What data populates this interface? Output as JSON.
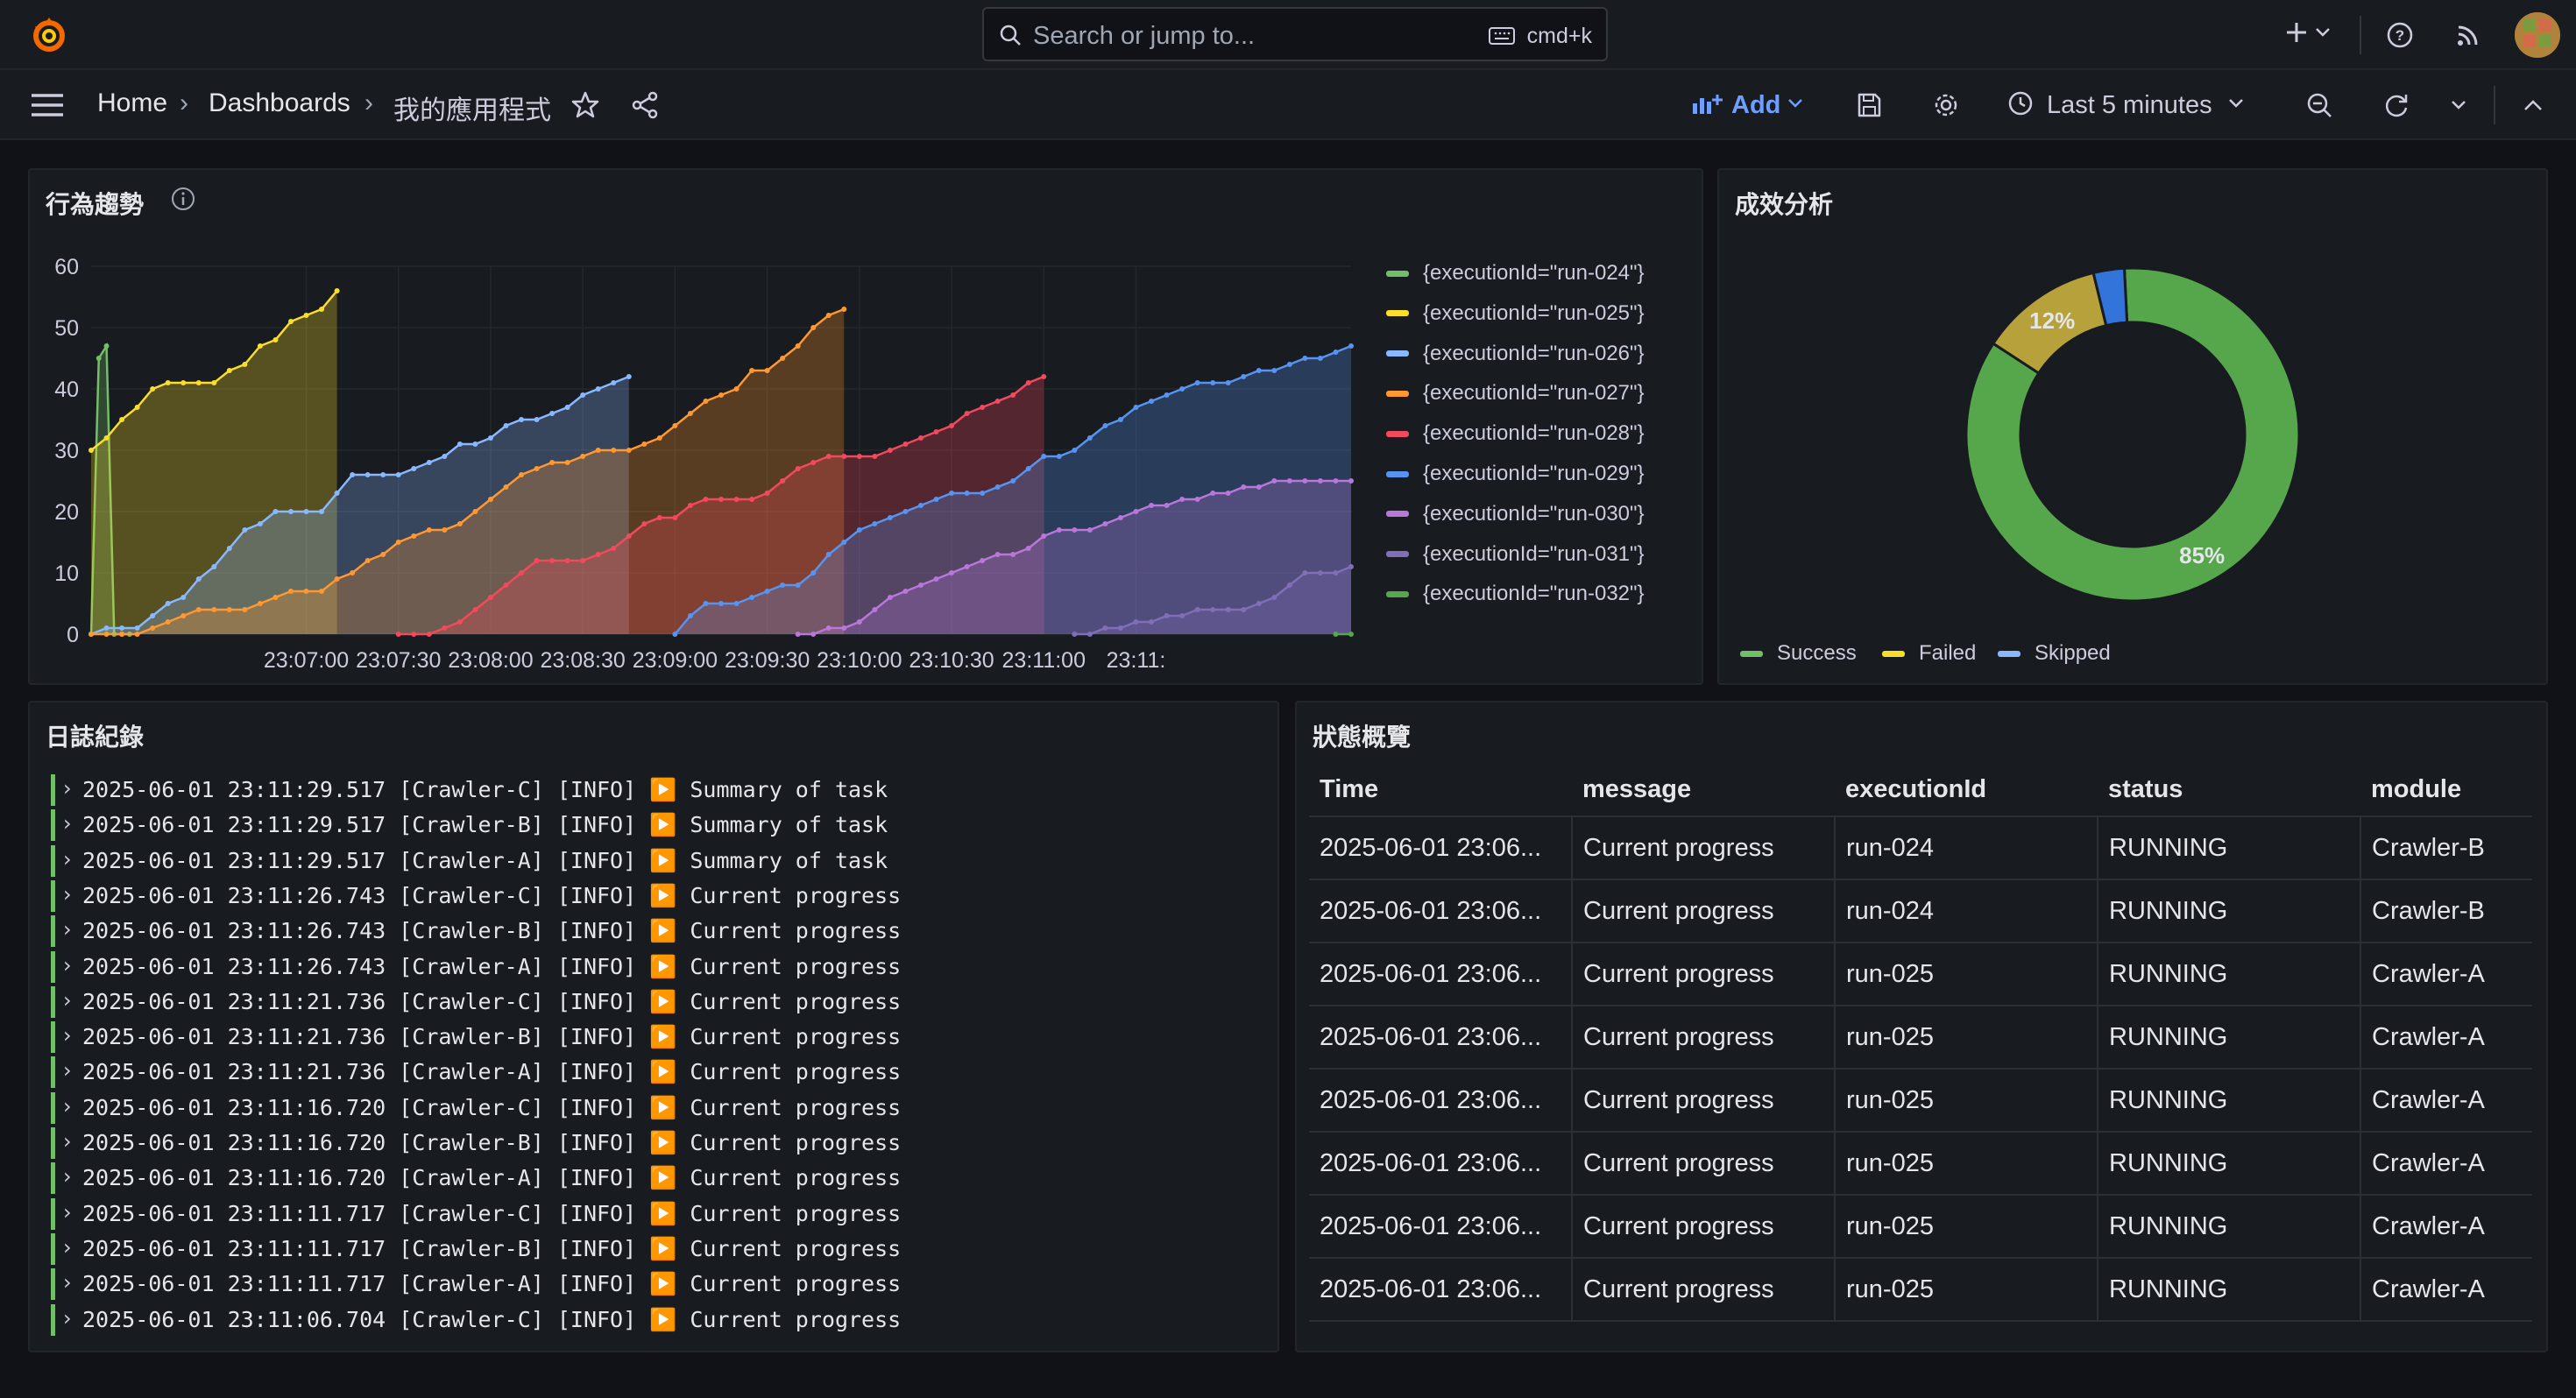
{
  "topbar": {
    "search_placeholder": "Search or jump to...",
    "search_shortcut": "cmd+k",
    "icons": [
      "grafana-logo-icon",
      "search-icon",
      "keyboard-icon",
      "plus-icon",
      "chevron-down-icon",
      "help-icon",
      "news-rss-icon",
      "user-avatar"
    ]
  },
  "breadcrumb": {
    "home": "Home",
    "dashboards": "Dashboards",
    "current": "我的應用程式"
  },
  "toolbar": {
    "add_label": "Add",
    "time_range": "Last 5 minutes",
    "accent": "#6e9fff"
  },
  "trend_panel": {
    "title": "行為趨勢",
    "chart_data": {
      "type": "area",
      "x_ticks": [
        "23:07:00",
        "23:07:30",
        "23:08:00",
        "23:08:30",
        "23:09:00",
        "23:09:30",
        "23:10:00",
        "23:10:30",
        "23:11:00",
        "23:11:"
      ],
      "y_ticks": [
        "0",
        "10",
        "20",
        "30",
        "40",
        "50",
        "60"
      ],
      "ylim": [
        0,
        60
      ],
      "legend_placement": "right",
      "grid": true,
      "series": [
        {
          "name": "{executionId=\"run-024\"}",
          "color": "#73bf69",
          "x": [
            0,
            2.5,
            5,
            7.5,
            10,
            12.5
          ],
          "y": [
            0,
            45,
            47,
            0,
            0,
            0
          ]
        },
        {
          "name": "{executionId=\"run-025\"}",
          "color": "#fade2a",
          "x": [
            0,
            5,
            10,
            15,
            20,
            25,
            30,
            35,
            40,
            45,
            50,
            55,
            60,
            65,
            70,
            75,
            80
          ],
          "y": [
            30,
            32,
            35,
            37,
            40,
            41,
            41,
            41,
            41,
            43,
            44,
            47,
            48,
            51,
            52,
            53,
            56
          ]
        },
        {
          "name": "{executionId=\"run-026\"}",
          "color": "#8ab8ff",
          "x": [
            0,
            5,
            10,
            15,
            20,
            25,
            30,
            35,
            40,
            45,
            50,
            55,
            60,
            65,
            70,
            75,
            80,
            85,
            90,
            95,
            100,
            105,
            110,
            115,
            120,
            125,
            130,
            135,
            140,
            145,
            150,
            155,
            160,
            165,
            170,
            175
          ],
          "y": [
            0,
            1,
            1,
            1,
            3,
            5,
            6,
            9,
            11,
            14,
            17,
            18,
            20,
            20,
            20,
            20,
            23,
            26,
            26,
            26,
            26,
            27,
            28,
            29,
            31,
            31,
            32,
            34,
            35,
            35,
            36,
            37,
            39,
            40,
            41,
            42
          ]
        },
        {
          "name": "{executionId=\"run-027\"}",
          "color": "#ff9830",
          "x": [
            0,
            5,
            10,
            15,
            20,
            25,
            30,
            35,
            40,
            45,
            50,
            55,
            60,
            65,
            70,
            75,
            80,
            85,
            90,
            95,
            100,
            105,
            110,
            115,
            120,
            125,
            130,
            135,
            140,
            145,
            150,
            155,
            160,
            165,
            170,
            175,
            180,
            185,
            190,
            195,
            200,
            205,
            210,
            215,
            220,
            225,
            230,
            235,
            240,
            245
          ],
          "y": [
            0,
            0,
            0,
            0,
            1,
            2,
            3,
            4,
            4,
            4,
            4,
            5,
            6,
            7,
            7,
            7,
            9,
            10,
            12,
            13,
            15,
            16,
            17,
            17,
            18,
            20,
            22,
            24,
            26,
            27,
            28,
            28,
            29,
            30,
            30,
            30,
            31,
            32,
            34,
            36,
            38,
            39,
            40,
            43,
            43,
            45,
            47,
            50,
            52,
            53
          ]
        },
        {
          "name": "{executionId=\"run-028\"}",
          "color": "#f2495c",
          "x": [
            100,
            105,
            110,
            115,
            120,
            125,
            130,
            135,
            140,
            145,
            150,
            155,
            160,
            165,
            170,
            175,
            180,
            185,
            190,
            195,
            200,
            205,
            210,
            215,
            220,
            225,
            230,
            235,
            240,
            245,
            250,
            255,
            260,
            265,
            270,
            275,
            280,
            285,
            290,
            295,
            300,
            305,
            310
          ],
          "y": [
            0,
            0,
            0,
            1,
            2,
            4,
            6,
            8,
            10,
            12,
            12,
            12,
            12,
            13,
            14,
            16,
            18,
            19,
            19,
            21,
            22,
            22,
            22,
            22,
            23,
            25,
            27,
            28,
            29,
            29,
            29,
            29,
            30,
            31,
            32,
            33,
            34,
            36,
            37,
            38,
            39,
            41,
            42
          ]
        },
        {
          "name": "{executionId=\"run-029\"}",
          "color": "#5794f2",
          "x": [
            190,
            195,
            200,
            205,
            210,
            215,
            220,
            225,
            230,
            235,
            240,
            245,
            250,
            255,
            260,
            265,
            270,
            275,
            280,
            285,
            290,
            295,
            300,
            305,
            310,
            315,
            320,
            325,
            330,
            335,
            340,
            345,
            350,
            355,
            360,
            365,
            370,
            375,
            380,
            385,
            390,
            395,
            400,
            405,
            410
          ],
          "y": [
            0,
            3,
            5,
            5,
            5,
            6,
            7,
            8,
            8,
            10,
            13,
            15,
            17,
            18,
            19,
            20,
            21,
            22,
            23,
            23,
            23,
            24,
            25,
            27,
            29,
            29,
            30,
            32,
            34,
            35,
            37,
            38,
            39,
            40,
            41,
            41,
            41,
            42,
            43,
            43,
            44,
            45,
            45,
            46,
            47
          ]
        },
        {
          "name": "{executionId=\"run-030\"}",
          "color": "#b877d9",
          "x": [
            230,
            235,
            240,
            245,
            250,
            255,
            260,
            265,
            270,
            275,
            280,
            285,
            290,
            295,
            300,
            305,
            310,
            315,
            320,
            325,
            330,
            335,
            340,
            345,
            350,
            355,
            360,
            365,
            370,
            375,
            380,
            385,
            390,
            395,
            400,
            405,
            410
          ],
          "y": [
            0,
            0,
            1,
            1,
            2,
            4,
            6,
            7,
            8,
            9,
            10,
            11,
            12,
            13,
            13,
            14,
            16,
            17,
            17,
            17,
            18,
            19,
            20,
            21,
            21,
            22,
            22,
            23,
            23,
            24,
            24,
            25,
            25,
            25,
            25,
            25,
            25
          ]
        },
        {
          "name": "{executionId=\"run-031\"}",
          "color": "#806eb7",
          "x": [
            320,
            325,
            330,
            335,
            340,
            345,
            350,
            355,
            360,
            365,
            370,
            375,
            380,
            385,
            390,
            395,
            400,
            405,
            410
          ],
          "y": [
            0,
            0,
            1,
            1,
            2,
            2,
            3,
            3,
            4,
            4,
            4,
            4,
            5,
            6,
            8,
            10,
            10,
            10,
            11
          ]
        },
        {
          "name": "{executionId=\"run-032\"}",
          "color": "#56a64b",
          "x": [
            405,
            410
          ],
          "y": [
            0,
            0
          ]
        }
      ]
    }
  },
  "pie_panel": {
    "title": "成效分析",
    "chart_data": {
      "type": "pie",
      "donut": true,
      "labels": [
        "Success",
        "Failed",
        "Skipped"
      ],
      "values": [
        85,
        12,
        3
      ],
      "colors": [
        "#73bf69",
        "#fade2a",
        "#8ab8ff"
      ],
      "slice_colors": [
        "#56a64b",
        "#b7a13a",
        "#3274d9"
      ],
      "data_labels": [
        "85%",
        "12%",
        ""
      ],
      "legend_placement": "bottom"
    }
  },
  "log_panel": {
    "title": "日誌紀錄",
    "level_color": "#73bf69",
    "lines": [
      "2025-06-01 23:11:29.517 [Crawler-C] [INFO] ▶️ Summary of task",
      "2025-06-01 23:11:29.517 [Crawler-B] [INFO] ▶️ Summary of task",
      "2025-06-01 23:11:29.517 [Crawler-A] [INFO] ▶️ Summary of task",
      "2025-06-01 23:11:26.743 [Crawler-C] [INFO] ▶️ Current progress",
      "2025-06-01 23:11:26.743 [Crawler-B] [INFO] ▶️ Current progress",
      "2025-06-01 23:11:26.743 [Crawler-A] [INFO] ▶️ Current progress",
      "2025-06-01 23:11:21.736 [Crawler-C] [INFO] ▶️ Current progress",
      "2025-06-01 23:11:21.736 [Crawler-B] [INFO] ▶️ Current progress",
      "2025-06-01 23:11:21.736 [Crawler-A] [INFO] ▶️ Current progress",
      "2025-06-01 23:11:16.720 [Crawler-C] [INFO] ▶️ Current progress",
      "2025-06-01 23:11:16.720 [Crawler-B] [INFO] ▶️ Current progress",
      "2025-06-01 23:11:16.720 [Crawler-A] [INFO] ▶️ Current progress",
      "2025-06-01 23:11:11.717 [Crawler-C] [INFO] ▶️ Current progress",
      "2025-06-01 23:11:11.717 [Crawler-B] [INFO] ▶️ Current progress",
      "2025-06-01 23:11:11.717 [Crawler-A] [INFO] ▶️ Current progress",
      "2025-06-01 23:11:06.704 [Crawler-C] [INFO] ▶️ Current progress"
    ]
  },
  "status_panel": {
    "title": "狀態概覽",
    "columns": [
      "Time",
      "message",
      "executionId",
      "status",
      "module"
    ],
    "rows": [
      [
        "2025-06-01 23:06...",
        "Current progress",
        "run-024",
        "RUNNING",
        "Crawler-B"
      ],
      [
        "2025-06-01 23:06...",
        "Current progress",
        "run-024",
        "RUNNING",
        "Crawler-B"
      ],
      [
        "2025-06-01 23:06...",
        "Current progress",
        "run-025",
        "RUNNING",
        "Crawler-A"
      ],
      [
        "2025-06-01 23:06...",
        "Current progress",
        "run-025",
        "RUNNING",
        "Crawler-A"
      ],
      [
        "2025-06-01 23:06...",
        "Current progress",
        "run-025",
        "RUNNING",
        "Crawler-A"
      ],
      [
        "2025-06-01 23:06...",
        "Current progress",
        "run-025",
        "RUNNING",
        "Crawler-A"
      ],
      [
        "2025-06-01 23:06...",
        "Current progress",
        "run-025",
        "RUNNING",
        "Crawler-A"
      ],
      [
        "2025-06-01 23:06...",
        "Current progress",
        "run-025",
        "RUNNING",
        "Crawler-A"
      ]
    ]
  }
}
